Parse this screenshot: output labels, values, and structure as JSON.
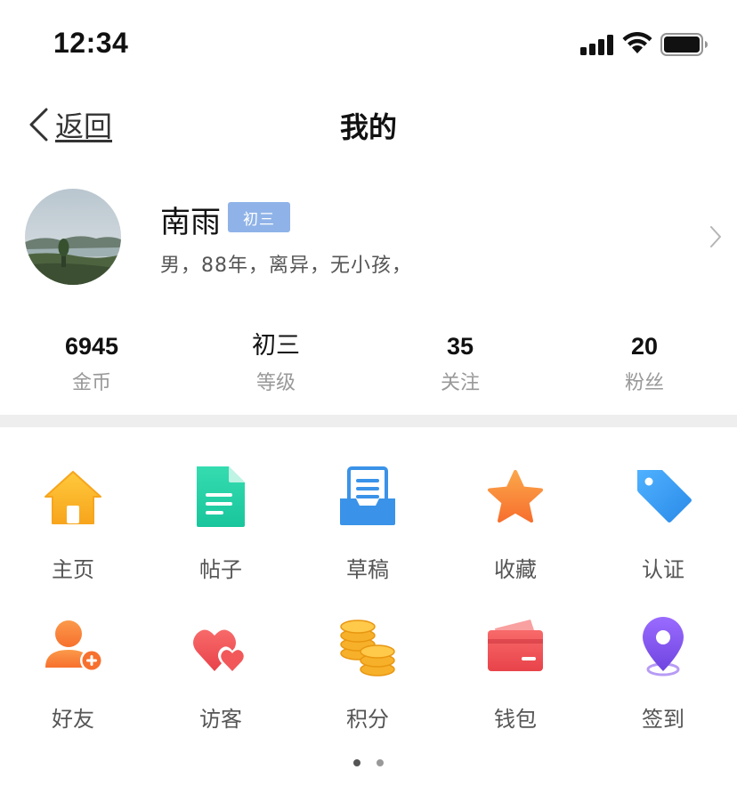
{
  "status_bar": {
    "time": "12:34",
    "icons": [
      "signal-icon",
      "wifi-icon",
      "battery-icon"
    ]
  },
  "nav": {
    "back_label": "返回",
    "title": "我的"
  },
  "profile": {
    "name": "南雨",
    "level_badge": "初三",
    "bio": "男，88年，离异，无小孩，",
    "badge_color": "#8fb3e8"
  },
  "stats": [
    {
      "value": "6945",
      "label": "金币"
    },
    {
      "value": "初三",
      "label": "等级"
    },
    {
      "value": "35",
      "label": "关注"
    },
    {
      "value": "20",
      "label": "粉丝"
    }
  ],
  "grid": {
    "items": [
      {
        "label": "主页",
        "icon": "home-icon",
        "color": "#f7b02a"
      },
      {
        "label": "帖子",
        "icon": "post-document-icon",
        "color": "#2bd3a7"
      },
      {
        "label": "草稿",
        "icon": "draft-tray-icon",
        "color": "#3a93e8"
      },
      {
        "label": "收藏",
        "icon": "star-icon",
        "color": "#f98a3a"
      },
      {
        "label": "认证",
        "icon": "tag-icon",
        "color": "#3a9bf0"
      },
      {
        "label": "好友",
        "icon": "add-friend-icon",
        "color": "#f98a3a"
      },
      {
        "label": "访客",
        "icon": "hearts-icon",
        "color": "#f2585a"
      },
      {
        "label": "积分",
        "icon": "coins-icon",
        "color": "#f7b02a"
      },
      {
        "label": "钱包",
        "icon": "wallet-card-icon",
        "color": "#f2585a"
      },
      {
        "label": "签到",
        "icon": "location-pin-icon",
        "color": "#8a5cf0"
      }
    ]
  },
  "pagination": {
    "pages": 2,
    "current": 1
  }
}
